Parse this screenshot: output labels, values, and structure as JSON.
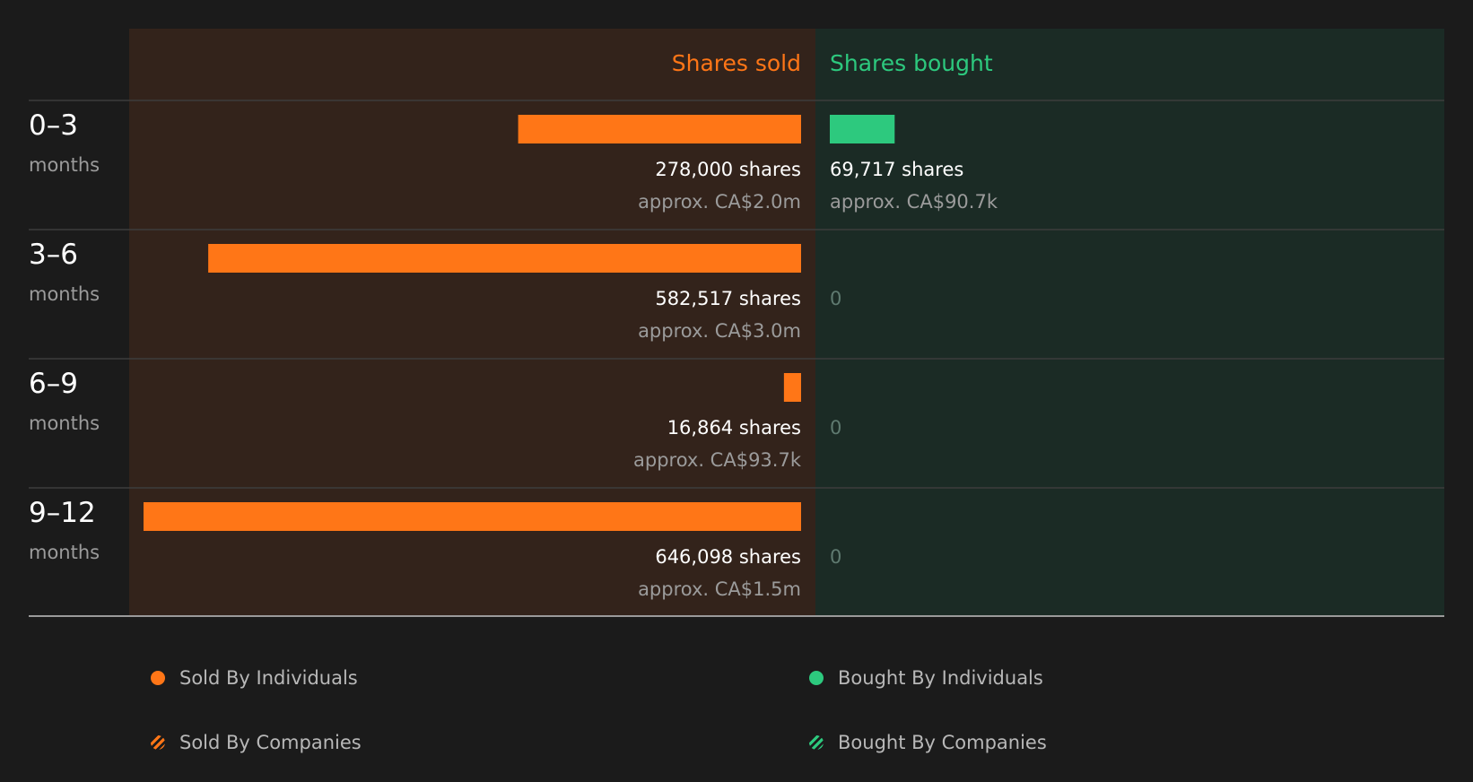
{
  "chart_data": {
    "type": "bar",
    "title": "",
    "headers": {
      "sold": "Shares sold",
      "bought": "Shares bought"
    },
    "period_unit": "months",
    "categories": [
      "0–3",
      "3–6",
      "6–9",
      "9–12"
    ],
    "series": [
      {
        "name": "Shares sold",
        "values": [
          278000,
          582517,
          16864,
          646098
        ],
        "labels": [
          "278,000 shares",
          "582,517 shares",
          "16,864 shares",
          "646,098 shares"
        ],
        "approx": [
          "approx. CA$2.0m",
          "approx. CA$3.0m",
          "approx. CA$93.7k",
          "approx. CA$1.5m"
        ]
      },
      {
        "name": "Shares bought",
        "values": [
          69717,
          0,
          0,
          0
        ],
        "labels": [
          "69,717 shares",
          "0",
          "0",
          "0"
        ],
        "approx": [
          "approx. CA$90.7k",
          "",
          "",
          ""
        ]
      }
    ],
    "xlim": [
      0,
      646098
    ],
    "legend": [
      "Sold By Individuals",
      "Sold By Companies",
      "Bought By Individuals",
      "Bought By Companies"
    ],
    "legend_position": "bottom"
  },
  "colors": {
    "background": "#1b1b1b",
    "sold_panel": "#33231b",
    "bought_panel": "#1b2b25",
    "sold": "#ff7617",
    "bought": "#2dc97e",
    "divider": "#3d3d3d",
    "axis": "#9a9a9a",
    "primary_text": "#ffffff",
    "secondary_text": "#9b9b9b",
    "zero_text": "#5f7a70"
  }
}
